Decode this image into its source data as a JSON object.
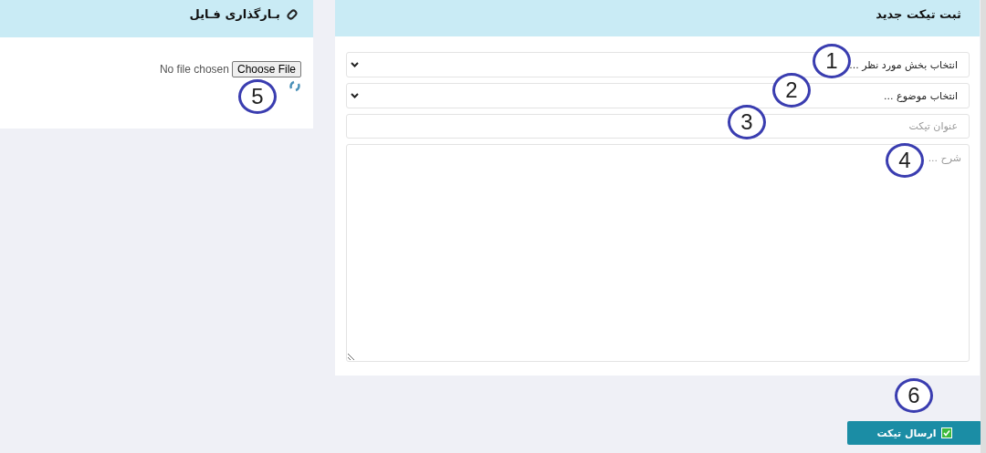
{
  "upload_panel": {
    "title": "بـارگذاری فـایل",
    "file_status": "No file chosen",
    "choose_button": "Choose File"
  },
  "ticket_panel": {
    "title": "ثبت تیکت جدید",
    "department_select": "انتخاب بخش مورد نظر ...",
    "subject_select": "انتخاب موضوع ...",
    "title_field": {
      "placeholder": "عنوان تیکت"
    },
    "description_field": {
      "placeholder": "شرح ..."
    }
  },
  "submit_button": "ارسال تیکت",
  "callouts": [
    {
      "label": "1"
    },
    {
      "label": "2"
    },
    {
      "label": "3"
    },
    {
      "label": "4"
    },
    {
      "label": "5"
    },
    {
      "label": "6"
    }
  ]
}
